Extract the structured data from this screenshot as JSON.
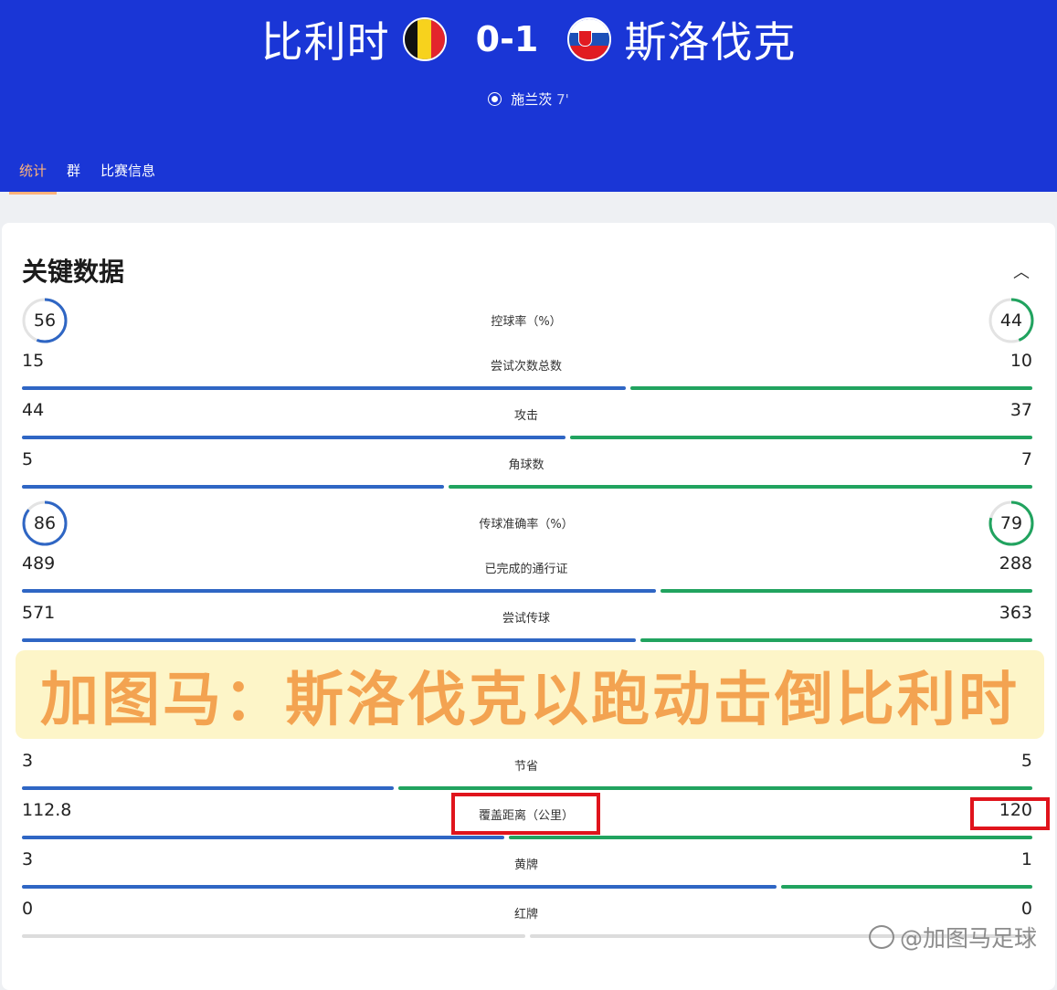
{
  "match": {
    "home_team": "比利时",
    "away_team": "斯洛伐克",
    "score": "0-1",
    "scorer": "施兰茨",
    "scorer_minute": "7'"
  },
  "tabs": [
    "统计",
    "群",
    "比赛信息"
  ],
  "section": {
    "title": "关键数据"
  },
  "stats": [
    {
      "label": "控球率（%）",
      "home": "56",
      "away": "44",
      "type": "circle",
      "home_fraction": 0.56,
      "away_fraction": 0.44
    },
    {
      "label": "尝试次数总数",
      "home": "15",
      "away": "10",
      "type": "bar",
      "home_fraction": 0.6
    },
    {
      "label": "攻击",
      "home": "44",
      "away": "37",
      "type": "bar",
      "home_fraction": 0.54
    },
    {
      "label": "角球数",
      "home": "5",
      "away": "7",
      "type": "bar",
      "home_fraction": 0.42
    },
    {
      "label": "传球准确率（%）",
      "home": "86",
      "away": "79",
      "type": "circle",
      "home_fraction": 0.86,
      "away_fraction": 0.79
    },
    {
      "label": "已完成的通行证",
      "home": "489",
      "away": "288",
      "type": "bar",
      "home_fraction": 0.63
    },
    {
      "label": "尝试传球",
      "home": "571",
      "away": "363",
      "type": "bar",
      "home_fraction": 0.61
    },
    {
      "label": "节省",
      "home": "3",
      "away": "5",
      "type": "bar",
      "home_fraction": 0.37
    },
    {
      "label": "覆盖距离（公里）",
      "home": "112.8",
      "away": "120",
      "type": "bar",
      "home_fraction": 0.48
    },
    {
      "label": "黄牌",
      "home": "3",
      "away": "1",
      "type": "bar",
      "home_fraction": 0.75
    },
    {
      "label": "红牌",
      "home": "0",
      "away": "0",
      "type": "bar",
      "home_fraction": 0.5,
      "empty": true
    }
  ],
  "overlay": {
    "headline": "加图马：斯洛伐克以跑动击倒比利时"
  },
  "watermark": "@加图马足球",
  "colors": {
    "header": "#1a36d6",
    "home_bar": "#2f66c4",
    "away_bar": "#21a35f",
    "active_tab": "#ffb37a",
    "highlight": "#e0141c"
  }
}
